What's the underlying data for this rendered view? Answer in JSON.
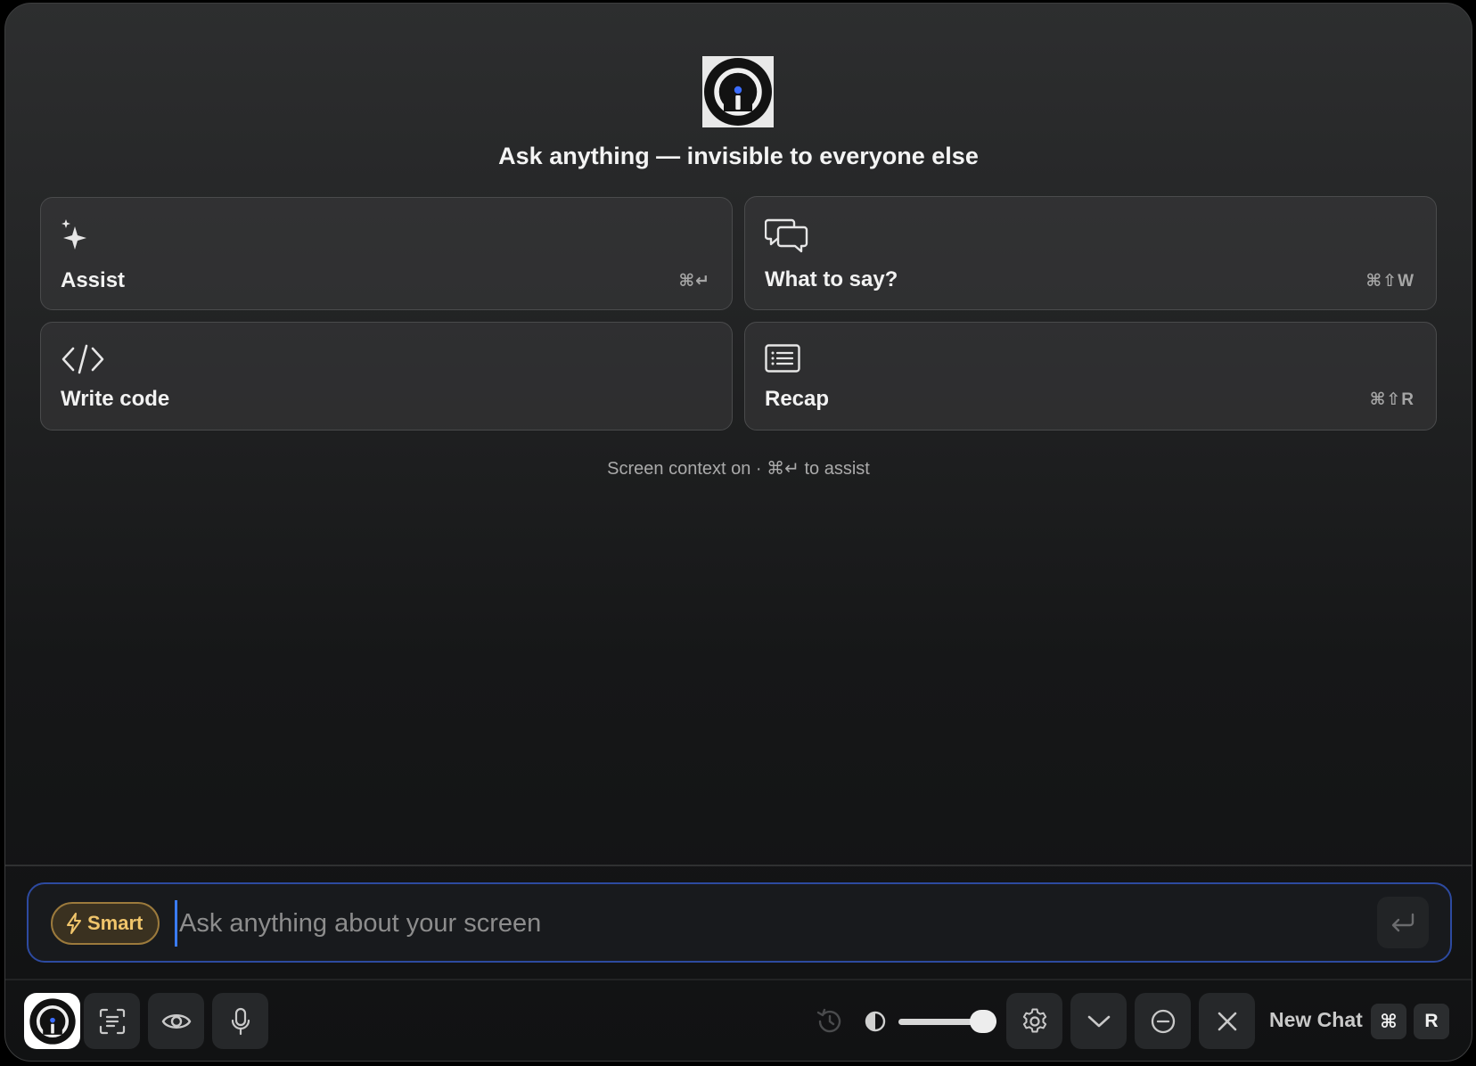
{
  "headline": "Ask anything — invisible to everyone else",
  "cards": [
    {
      "label": "Assist",
      "shortcut": "⌘↵",
      "icon": "sparkles-icon"
    },
    {
      "label": "What to say?",
      "shortcut": "⌘⇧W",
      "icon": "chat-bubbles-icon"
    },
    {
      "label": "Write code",
      "shortcut": "",
      "icon": "code-icon"
    },
    {
      "label": "Recap",
      "shortcut": "⌘⇧R",
      "icon": "list-icon"
    }
  ],
  "hint": "Screen context on · ⌘↵ to assist",
  "input": {
    "mode_label": "Smart",
    "placeholder": "Ask anything about your screen",
    "value": ""
  },
  "toolbar": {
    "new_chat_label": "New Chat",
    "new_chat_keys": [
      "⌘",
      "R"
    ],
    "opacity_level": 0.9
  },
  "colors": {
    "accent_border": "#2d4aa0",
    "smart_gold": "#f0c56b",
    "cursor_blue": "#3a7cff"
  }
}
